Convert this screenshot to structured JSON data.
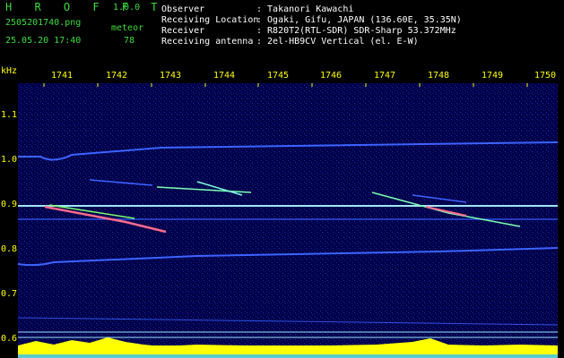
{
  "app": {
    "logo": "H R O F F T",
    "version": "1.0.0"
  },
  "header": {
    "filename": "2505201740.png",
    "datetime": "25.05.20 17:40",
    "meteor_label": "meteor",
    "meteor_count": "78",
    "fields": [
      {
        "label": "Observer",
        "value": ": Takanori Kawachi"
      },
      {
        "label": "Receiving Location",
        "value": ": Ogaki, Gifu, JAPAN (136.60E, 35.35N)"
      },
      {
        "label": "Receiver",
        "value": ": R820T2(RTL-SDR) SDR-Sharp 53.372MHz"
      },
      {
        "label": "Receiving antenna",
        "value": ": 2el-HB9CV Vertical (el. E-W)"
      }
    ]
  },
  "axes": {
    "y_unit": "kHz",
    "y_ticks": [
      "1.1",
      "1.0",
      "0.9",
      "0.8",
      "0.7",
      "0.6"
    ],
    "x_ticks": [
      "1741",
      "1742",
      "1743",
      "1744",
      "1745",
      "1746",
      "1747",
      "1748",
      "1749",
      "1750"
    ]
  },
  "colors": {
    "background": "#00004a",
    "text": "#ffff00",
    "label": "#3cdc3c",
    "signal": "#3c64ff",
    "reference": "#a0e6ff",
    "level_bar": "#ffff00"
  }
}
